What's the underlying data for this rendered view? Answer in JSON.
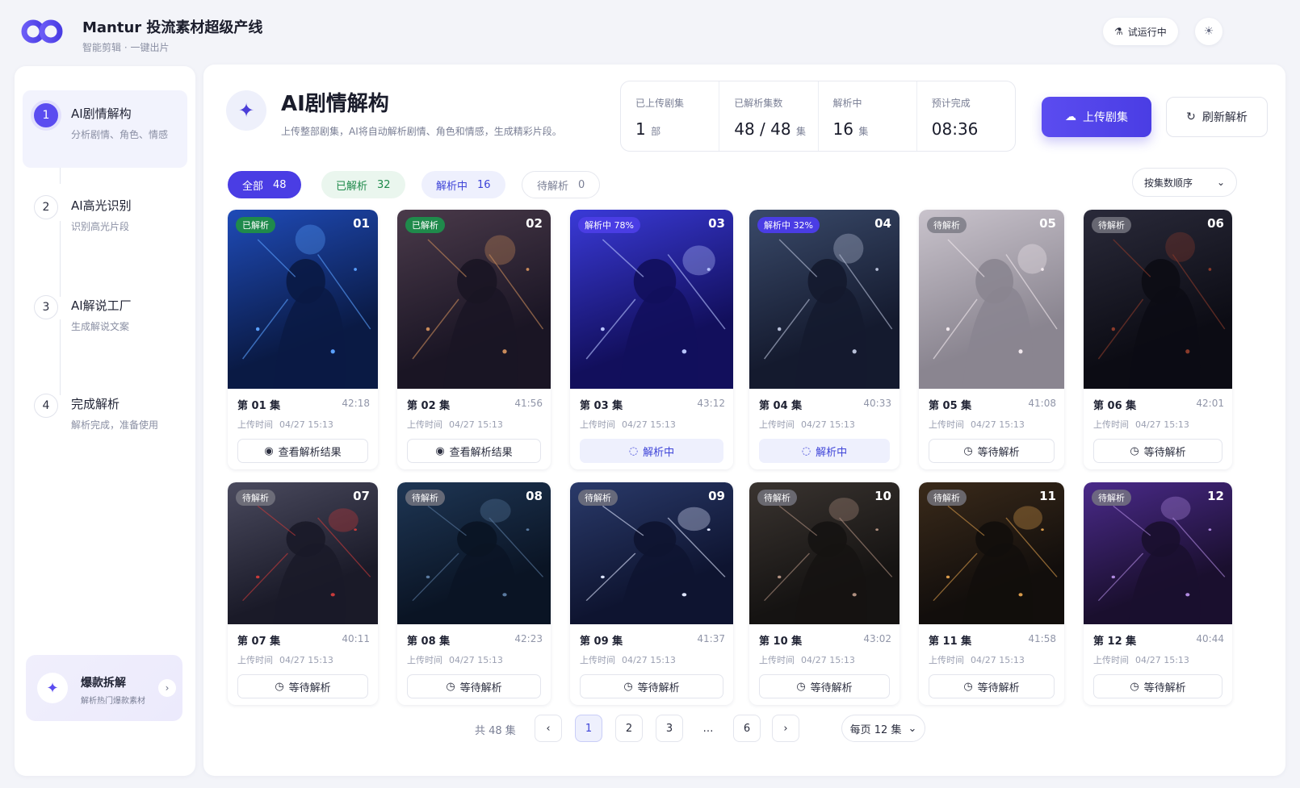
{
  "app": {
    "title": "Mantur 投流素材超级产线",
    "subtitle": "智能剪辑 · 一键出片",
    "trial_label": "试运行中"
  },
  "colors": {
    "accent": "#4a3de4",
    "done": "#1f8a4b",
    "processing": "#3e44d8",
    "waiting": "#7a7f95"
  },
  "sidebar": {
    "steps": [
      {
        "num": "1",
        "title": "AI剧情解构",
        "desc": "分析剧情、角色、情感",
        "active": true
      },
      {
        "num": "2",
        "title": "AI高光识别",
        "desc": "识别高光片段",
        "active": false
      },
      {
        "num": "3",
        "title": "AI解说工厂",
        "desc": "生成解说文案",
        "active": false
      },
      {
        "num": "4",
        "title": "完成解析",
        "desc": "解析完成，准备使用",
        "active": false
      }
    ],
    "promo": {
      "title": "爆款拆解",
      "desc": "解析热门爆款素材"
    }
  },
  "header": {
    "title": "AI剧情解构",
    "desc": "上传整部剧集，AI将自动解析剧情、角色和情感，生成精彩片段。",
    "stats": [
      {
        "label": "已上传剧集",
        "value": "1",
        "unit": "部"
      },
      {
        "label": "已解析集数",
        "value": "48 / 48",
        "unit": "集"
      },
      {
        "label": "解析中",
        "value": "16",
        "unit": "集"
      },
      {
        "label": "预计完成",
        "value": "08:36",
        "unit": ""
      }
    ],
    "upload_label": "上传剧集",
    "refresh_label": "刷新解析"
  },
  "filters": {
    "all": {
      "label": "全部",
      "count": "48"
    },
    "done": {
      "label": "已解析",
      "count": "32"
    },
    "processing": {
      "label": "解析中",
      "count": "16"
    },
    "waiting": {
      "label": "待解析",
      "count": "0"
    },
    "sort_label": "按集数顺序"
  },
  "upload_time_label": "上传时间",
  "episodes": [
    {
      "num": "01",
      "title": "第 01 集",
      "duration": "42:18",
      "time": "04/27 15:13",
      "badge": "已解析",
      "status": "done",
      "action": "查看解析结果",
      "palette": [
        "#0a1a44",
        "#1f4bb8",
        "#5aa0ff"
      ]
    },
    {
      "num": "02",
      "title": "第 02 集",
      "duration": "41:56",
      "time": "04/27 15:13",
      "badge": "已解析",
      "status": "done",
      "action": "查看解析结果",
      "palette": [
        "#1a1524",
        "#4a3a4a",
        "#c88a5a"
      ]
    },
    {
      "num": "03",
      "title": "第 03 集",
      "duration": "43:12",
      "time": "04/27 15:13",
      "badge": "解析中 78%",
      "status": "ing",
      "action": "解析中",
      "palette": [
        "#120f5c",
        "#3a3ad8",
        "#b7c4ff"
      ]
    },
    {
      "num": "04",
      "title": "第 04 集",
      "duration": "40:33",
      "time": "04/27 15:13",
      "badge": "解析中 32%",
      "status": "ing",
      "action": "解析中",
      "palette": [
        "#141a2e",
        "#3a4a6a",
        "#b8c0d8"
      ]
    },
    {
      "num": "05",
      "title": "第 05 集",
      "duration": "41:08",
      "time": "04/27 15:13",
      "badge": "待解析",
      "status": "wait",
      "action": "等待解析",
      "palette": [
        "#8a8590",
        "#c9c3cc",
        "#f2e9ee"
      ]
    },
    {
      "num": "06",
      "title": "第 06 集",
      "duration": "42:01",
      "time": "04/27 15:13",
      "badge": "待解析",
      "status": "wait",
      "action": "等待解析",
      "palette": [
        "#0c0c14",
        "#2a2a3a",
        "#8a3a2a"
      ]
    },
    {
      "num": "07",
      "title": "第 07 集",
      "duration": "40:11",
      "time": "04/27 15:13",
      "badge": "待解析",
      "status": "wait",
      "action": "等待解析",
      "palette": [
        "#1a1a28",
        "#4a4a5e",
        "#c83a3a"
      ]
    },
    {
      "num": "08",
      "title": "第 08 集",
      "duration": "42:23",
      "time": "04/27 15:13",
      "badge": "待解析",
      "status": "wait",
      "action": "等待解析",
      "palette": [
        "#0a1424",
        "#1e3654",
        "#5a7aa0"
      ]
    },
    {
      "num": "09",
      "title": "第 09 集",
      "duration": "41:37",
      "time": "04/27 15:13",
      "badge": "待解析",
      "status": "wait",
      "action": "等待解析",
      "palette": [
        "#0e1430",
        "#2a3a6a",
        "#dfe6ff"
      ]
    },
    {
      "num": "10",
      "title": "第 10 集",
      "duration": "43:02",
      "time": "04/27 15:13",
      "badge": "待解析",
      "status": "wait",
      "action": "等待解析",
      "palette": [
        "#151312",
        "#3a3430",
        "#b09080"
      ]
    },
    {
      "num": "11",
      "title": "第 11 集",
      "duration": "41:58",
      "time": "04/27 15:13",
      "badge": "待解析",
      "status": "wait",
      "action": "等待解析",
      "palette": [
        "#120e0c",
        "#3a2a1a",
        "#d89a4a"
      ]
    },
    {
      "num": "12",
      "title": "第 12 集",
      "duration": "40:44",
      "time": "04/27 15:13",
      "badge": "待解析",
      "status": "wait",
      "action": "等待解析",
      "palette": [
        "#1a0f2e",
        "#4a2a8a",
        "#b08ae0"
      ]
    }
  ],
  "pagination": {
    "total": "共 48 集",
    "pages": [
      "1",
      "2",
      "3",
      "…",
      "6"
    ],
    "current": "1",
    "per_page": "每页 12 集"
  },
  "icons": {
    "prev": "chevron-left-icon",
    "next": "chevron-right-icon",
    "view": "eye-icon",
    "processing": "spinner-icon",
    "waiting": "clock-icon"
  }
}
